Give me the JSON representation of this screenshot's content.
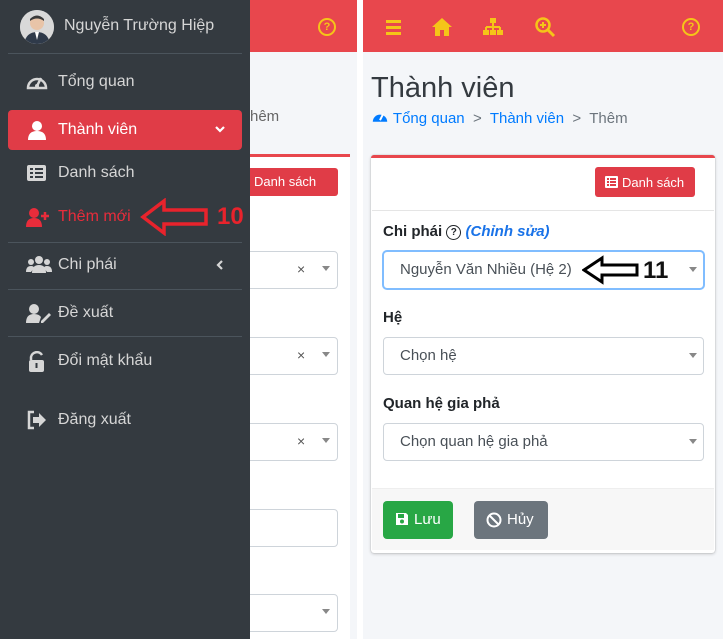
{
  "sidebar": {
    "user_name": "Nguyễn Trường Hiệp",
    "items": [
      {
        "label": "Tổng quan",
        "icon": "dashboard-gauge-icon"
      },
      {
        "label": "Thành viên",
        "icon": "user-icon"
      },
      {
        "label": "Danh sách",
        "icon": "list-icon"
      },
      {
        "label": "Thêm mới",
        "icon": "user-plus-icon"
      },
      {
        "label": "Chi phái",
        "icon": "users-group-icon"
      },
      {
        "label": "Đề xuất",
        "icon": "user-edit-icon"
      },
      {
        "label": "Đổi mật khẩu",
        "icon": "unlock-icon"
      },
      {
        "label": "Đăng xuất",
        "icon": "sign-out-icon"
      }
    ]
  },
  "left_background": {
    "crumb_partial": "hêm",
    "list_button": "Danh sách",
    "select_clear": "×"
  },
  "header": {
    "help": "?"
  },
  "page": {
    "title": "Thành viên",
    "breadcrumb": {
      "home": "Tổng quan",
      "section": "Thành viên",
      "sep": ">",
      "current": "Thêm"
    }
  },
  "form": {
    "list_button": "Danh sách",
    "branch_label": "Chi phái",
    "branch_edit": "(Chỉnh sửa)",
    "branch_value": "Nguyễn Văn Nhiều (Hệ 2)",
    "generation_label": "Hệ",
    "generation_placeholder": "Chọn hệ",
    "relation_label": "Quan hệ gia phả",
    "relation_placeholder": "Chọn quan hệ gia phả",
    "save_label": "Lưu",
    "cancel_label": "Hủy"
  },
  "annotations": {
    "step_a": "10",
    "step_b": "11"
  },
  "colors": {
    "accent_red": "#e8474d",
    "sidebar_bg": "#343a40",
    "link_blue": "#007bff",
    "save_green": "#28a745",
    "cancel_gray": "#6c757d",
    "icon_yellow": "#f5c518"
  }
}
